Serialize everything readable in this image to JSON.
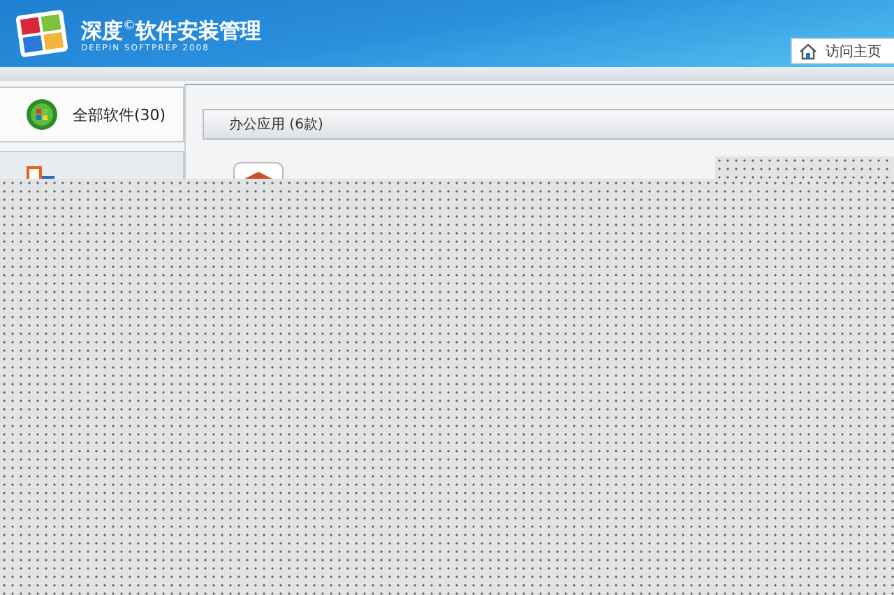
{
  "header": {
    "title": "深度$^{©}$软件安装管理",
    "subtitle": "DEEPIN SOFTPREP 2008",
    "home_link": "访问主页"
  },
  "sidebar": {
    "items": [
      {
        "label": "全部软件(30)",
        "selected": true,
        "kind": "all"
      },
      {
        "selected": false,
        "kind": "office"
      }
    ]
  },
  "main": {
    "category_header": "办公应用 (6款)"
  },
  "overlay": {
    "shown": true
  }
}
